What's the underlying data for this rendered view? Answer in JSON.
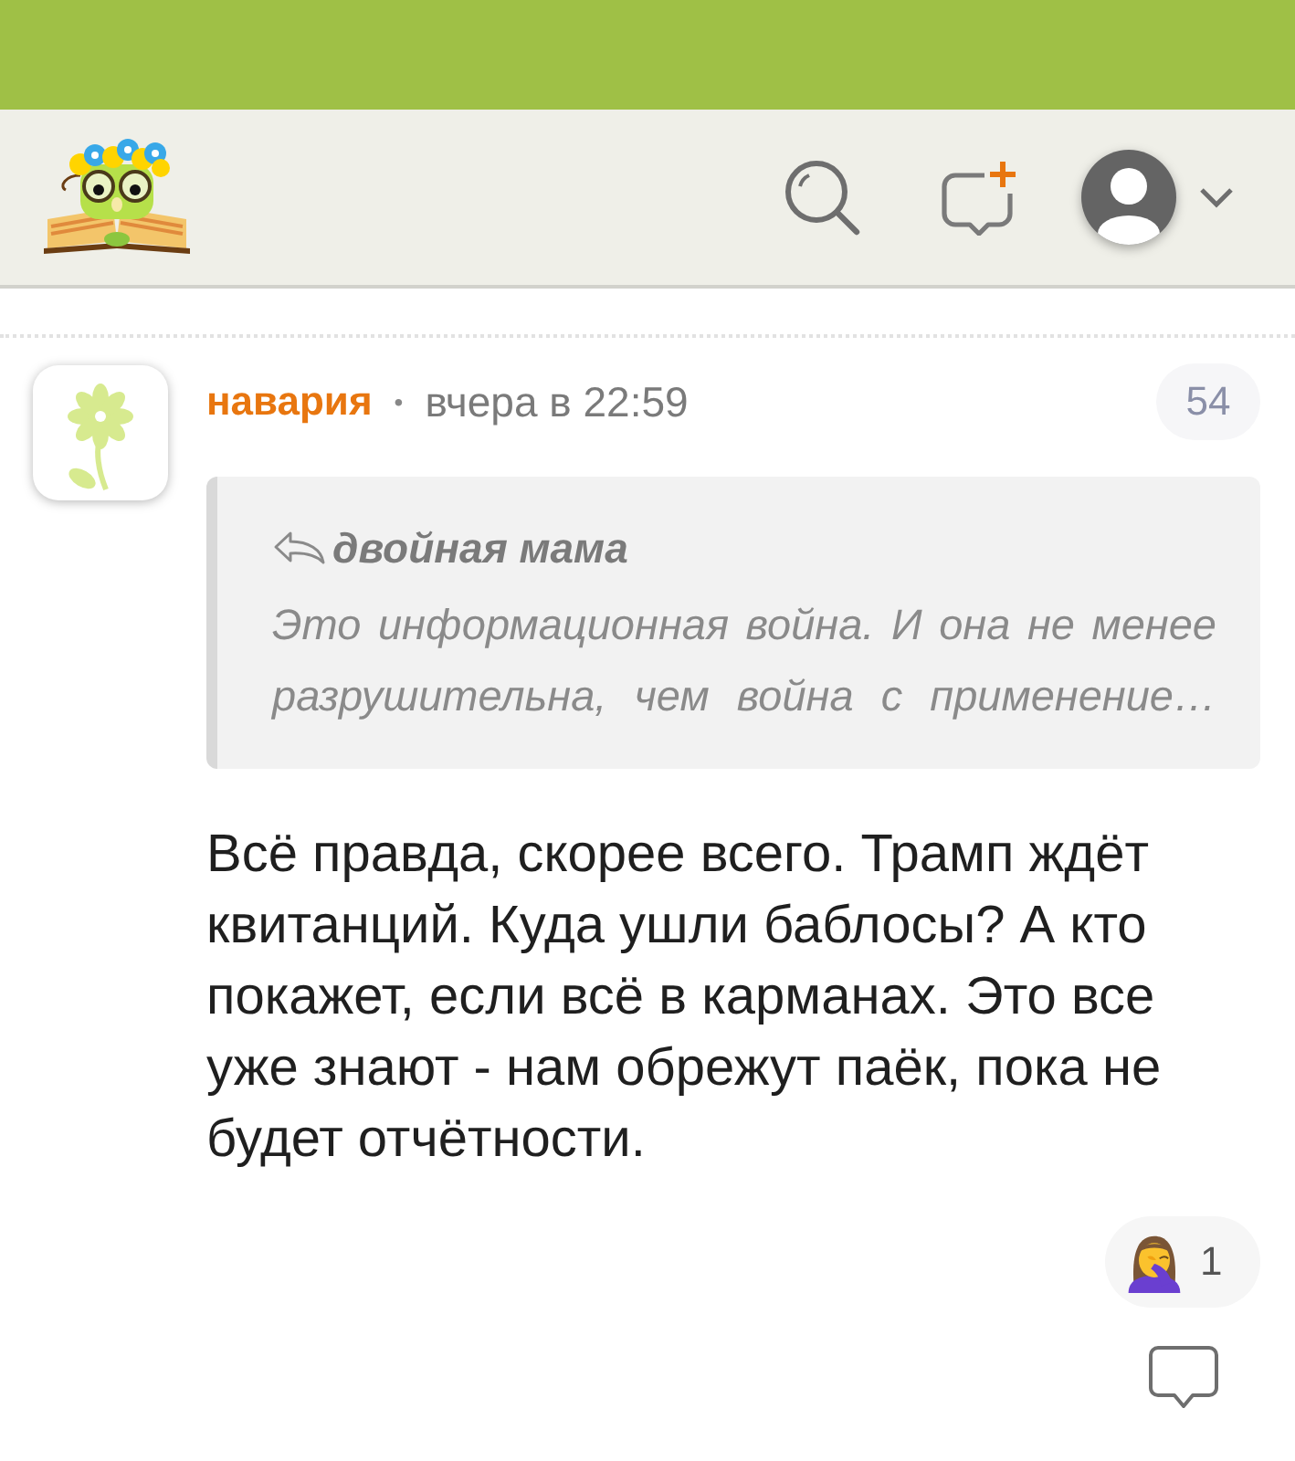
{
  "comment": {
    "author": "навария",
    "separator": "•",
    "time": "вчера в 22:59",
    "number": "54",
    "quote": {
      "author": "двойная мама",
      "text": "Это информационная война. И она не менее разрушительна, чем война с применение…"
    },
    "text": "Всё правда, скорее всего. Трамп ждёт квитанций. Куда ушли баблосы? А кто покажет, если всё в карманах. Это все уже знают - нам обрежут паёк, пока не будет отчётности.",
    "reactions": [
      {
        "count": "1",
        "selected": false
      }
    ]
  }
}
